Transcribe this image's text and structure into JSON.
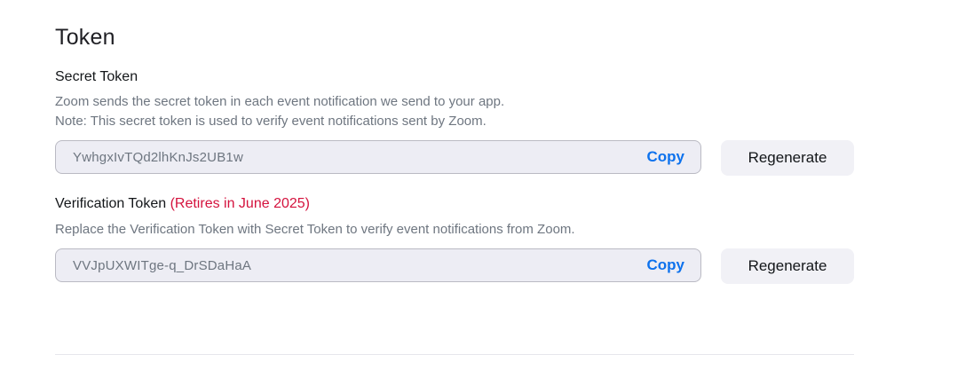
{
  "section": {
    "title": "Token"
  },
  "secret_token": {
    "label": "Secret Token",
    "description_line1": "Zoom sends the secret token in each event notification we send to your app.",
    "description_line2": "Note: This secret token is used to verify event notifications sent by Zoom.",
    "value": "YwhgxIvTQd2lhKnJs2UB1w",
    "copy_label": "Copy",
    "regenerate_label": "Regenerate"
  },
  "verification_token": {
    "label": "Verification Token",
    "retire_note": "(Retires in June 2025)",
    "description": "Replace the Verification Token with Secret Token to verify event notifications from Zoom.",
    "value": "VVJpUXWITge-q_DrSDaHaA",
    "copy_label": "Copy",
    "regenerate_label": "Regenerate"
  },
  "colors": {
    "accent": "#0e72ed",
    "warning": "#d4123d",
    "field_bg": "#ededf4",
    "button_bg": "#f1f1f6"
  }
}
